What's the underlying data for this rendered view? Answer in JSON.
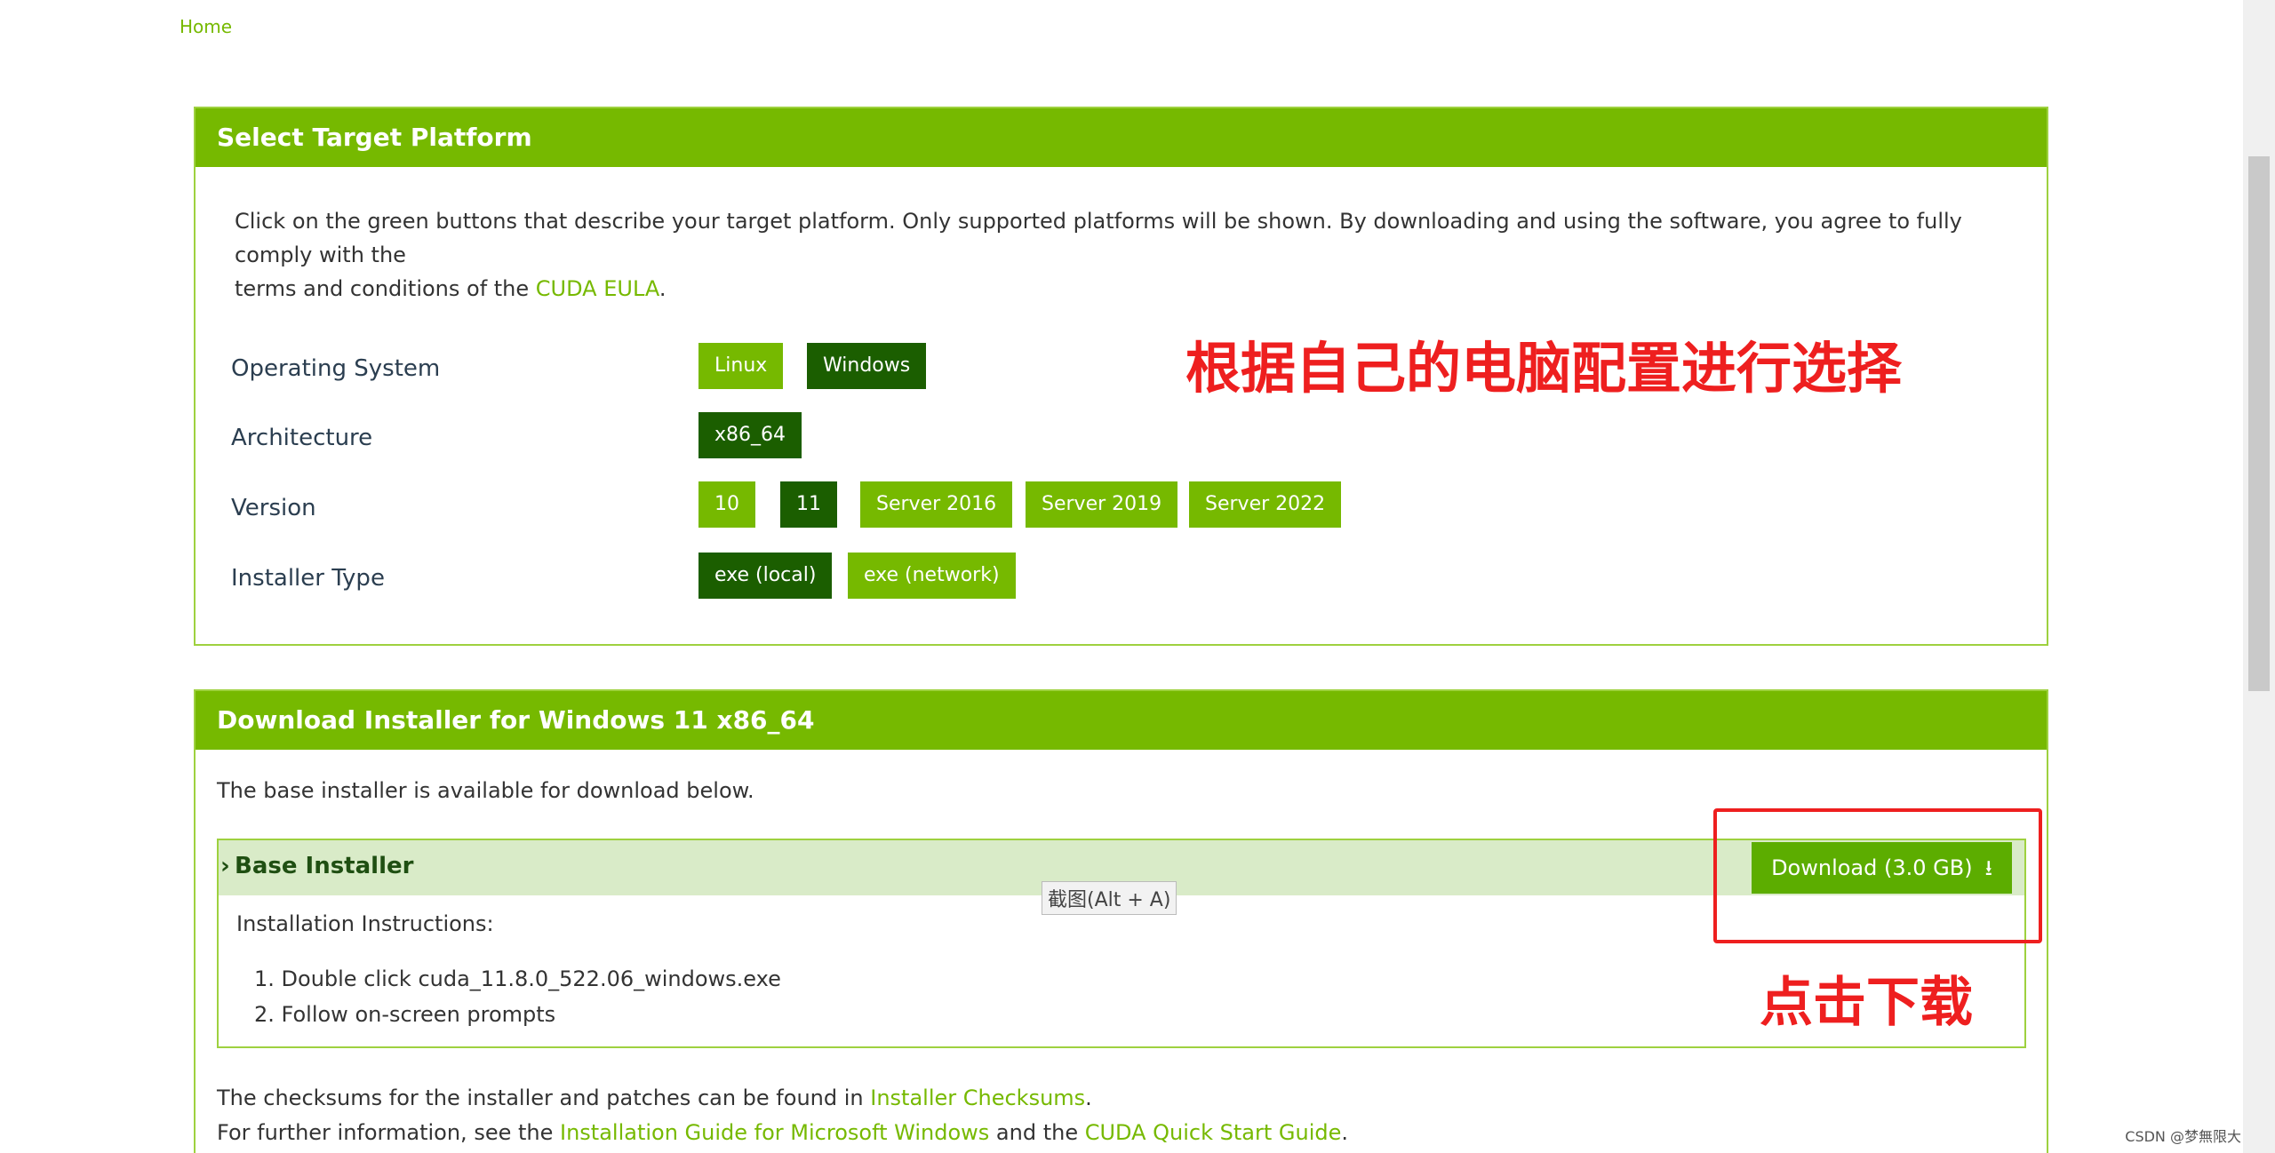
{
  "breadcrumb": {
    "home": "Home"
  },
  "select_panel": {
    "title": "Select Target Platform",
    "intro_1": "Click on the green buttons that describe your target platform. Only supported platforms will be shown. By downloading and using the software, you agree to fully comply with the",
    "intro_2_prefix": "terms and conditions of the ",
    "intro_link": "CUDA EULA",
    "intro_2_suffix": ".",
    "rows": {
      "os": {
        "label": "Operating System",
        "options": [
          "Linux",
          "Windows"
        ],
        "selected": "Windows"
      },
      "arch": {
        "label": "Architecture",
        "options": [
          "x86_64"
        ],
        "selected": "x86_64"
      },
      "version": {
        "label": "Version",
        "options": [
          "10",
          "11",
          "Server 2016",
          "Server 2019",
          "Server 2022"
        ],
        "selected": "11"
      },
      "installer": {
        "label": "Installer Type",
        "options": [
          "exe (local)",
          "exe (network)"
        ],
        "selected": "exe (local)"
      }
    }
  },
  "annotations": {
    "choose_config": "根据自己的电脑配置进行选择",
    "click_download": "点击下载"
  },
  "download_panel": {
    "title": "Download Installer for Windows 11 x86_64",
    "base_text": "The base installer is available for download below.",
    "base_installer": {
      "title": "Base Installer",
      "download_label": "Download (3.0 GB)",
      "instructions_title": "Installation Instructions:",
      "steps": [
        "1. Double click cuda_11.8.0_522.06_windows.exe",
        "2. Follow on-screen prompts"
      ]
    },
    "checksum_prefix": "The checksums for the installer and patches can be found in ",
    "checksum_link": "Installer Checksums",
    "checksum_suffix": ".",
    "info_prefix": "For further information, see the ",
    "info_link1": "Installation Guide for Microsoft Windows",
    "info_mid": " and the ",
    "info_link2": "CUDA Quick Start Guide",
    "info_suffix": "."
  },
  "tooltip": "截图(Alt + A)",
  "watermark": "CSDN @梦無限大",
  "colors": {
    "brand_green": "#76b900",
    "selected_green": "#1b5e00",
    "annotation_red": "#ee1f1f"
  }
}
